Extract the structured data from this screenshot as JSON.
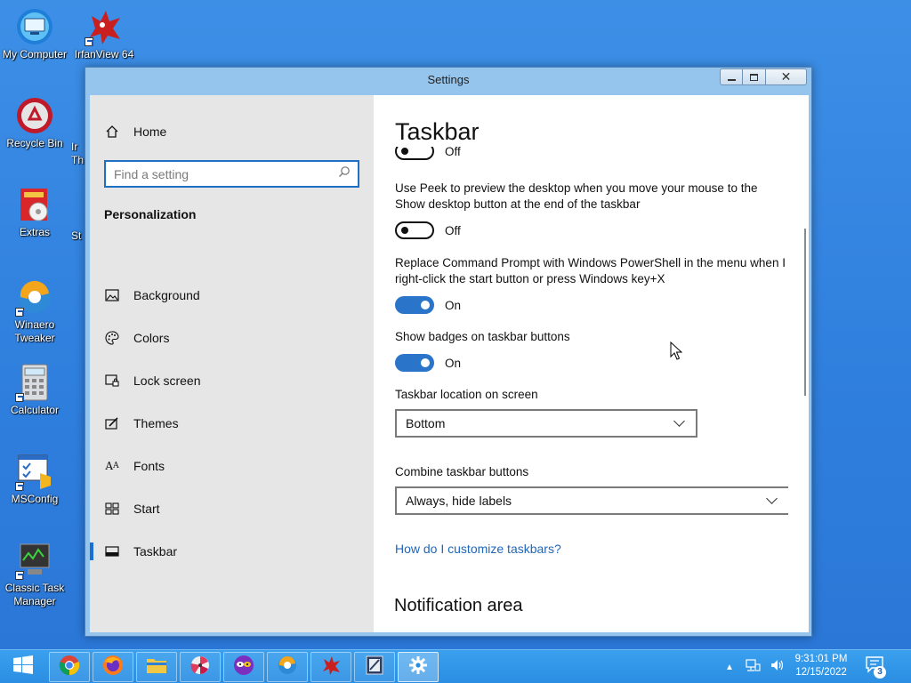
{
  "desktop": {
    "icons": [
      {
        "label": "My Computer"
      },
      {
        "label": "IrfanView 64"
      },
      {
        "label": "Recycle Bin"
      },
      {
        "label": "Ir Th"
      },
      {
        "label": "Extras"
      },
      {
        "label": "St"
      },
      {
        "label": "Winaero Tweaker"
      },
      {
        "label": "Calculator"
      },
      {
        "label": "MSConfig"
      },
      {
        "label": "Classic Task Manager"
      }
    ]
  },
  "window": {
    "title": "Settings",
    "controls": {
      "minimize": "minimize-icon",
      "maximize": "restore-icon",
      "close": "close-icon"
    }
  },
  "sidebar": {
    "home_label": "Home",
    "search_placeholder": "Find a setting",
    "section_title": "Personalization",
    "items": [
      {
        "label": "Background",
        "icon": "picture-icon"
      },
      {
        "label": "Colors",
        "icon": "palette-icon"
      },
      {
        "label": "Lock screen",
        "icon": "lock-screen-icon"
      },
      {
        "label": "Themes",
        "icon": "themes-icon"
      },
      {
        "label": "Fonts",
        "icon": "fonts-icon"
      },
      {
        "label": "Start",
        "icon": "start-icon"
      },
      {
        "label": "Taskbar",
        "icon": "taskbar-icon",
        "active": true
      }
    ],
    "accent": "#1a6fd1"
  },
  "main": {
    "title": "Taskbar",
    "top_toggle_state": "Off",
    "peek_text": "Use Peek to preview the desktop when you move your mouse to the Show desktop button at the end of the taskbar",
    "peek_state": "Off",
    "powershell_text": "Replace Command Prompt with Windows PowerShell in the menu when I right-click the start button or press Windows key+X",
    "powershell_state": "On",
    "badges_text": "Show badges on taskbar buttons",
    "badges_state": "On",
    "location_label": "Taskbar location on screen",
    "location_value": "Bottom",
    "combine_label": "Combine taskbar buttons",
    "combine_value": "Always, hide labels",
    "help_link": "How do I customize taskbars?",
    "notification_heading": "Notification area",
    "toggle_on_color": "#2a74c9"
  },
  "taskbar": {
    "apps": [
      {
        "name": "chrome-icon"
      },
      {
        "name": "firefox-icon"
      },
      {
        "name": "file-explorer-icon"
      },
      {
        "name": "pinwheel-app-icon"
      },
      {
        "name": "masks-app-icon"
      },
      {
        "name": "winaero-icon"
      },
      {
        "name": "irfanview-icon"
      },
      {
        "name": "image-app-icon"
      },
      {
        "name": "settings-gear-icon",
        "active": true
      }
    ],
    "clock_time": "9:31:01 PM",
    "clock_date": "12/15/2022",
    "notification_count": "3"
  }
}
